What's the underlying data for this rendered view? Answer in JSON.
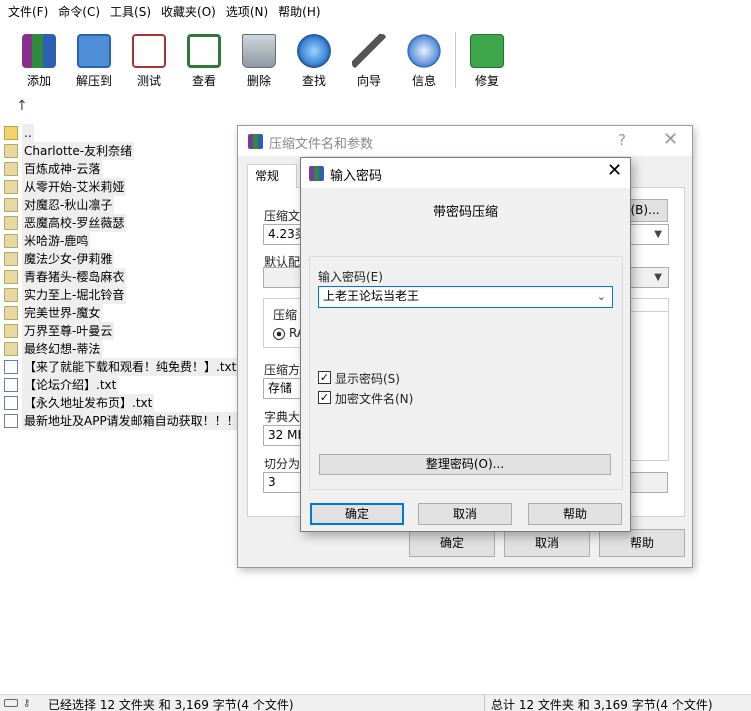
{
  "menu": [
    "文件(F)",
    "命令(C)",
    "工具(S)",
    "收藏夹(O)",
    "选项(N)",
    "帮助(H)"
  ],
  "toolbar": {
    "add": "添加",
    "extract": "解压到",
    "test": "测试",
    "view": "查看",
    "delete": "删除",
    "find": "查找",
    "wizard": "向导",
    "info": "信息",
    "repair": "修复"
  },
  "files": [
    {
      "name": "..",
      "type": "up"
    },
    {
      "name": "Charlotte-友利奈绪",
      "type": "folder"
    },
    {
      "name": "百炼成神-云落",
      "type": "folder"
    },
    {
      "name": "从零开始-艾米莉娅",
      "type": "folder"
    },
    {
      "name": "对魔忍-秋山凛子",
      "type": "folder"
    },
    {
      "name": "恶魔高校-罗丝薇瑟",
      "type": "folder"
    },
    {
      "name": "米哈游-鹿鸣",
      "type": "folder"
    },
    {
      "name": "魔法少女-伊莉雅",
      "type": "folder"
    },
    {
      "name": "青春猪头-樱岛麻衣",
      "type": "folder"
    },
    {
      "name": "实力至上-堀北铃音",
      "type": "folder"
    },
    {
      "name": "完美世界-魔女",
      "type": "folder"
    },
    {
      "name": "万界至尊-叶曼云",
      "type": "folder"
    },
    {
      "name": "最终幻想-蒂法",
      "type": "folder"
    },
    {
      "name": "【来了就能下载和观看！纯免费！】.txt",
      "type": "txt"
    },
    {
      "name": "【论坛介绍】.txt",
      "type": "txt"
    },
    {
      "name": "【永久地址发布页】.txt",
      "type": "txt"
    },
    {
      "name": "最新地址及APP请发邮箱自动获取！！！.",
      "type": "txt"
    }
  ],
  "status": {
    "left": "已经选择 12 文件夹 和 3,169 字节(4 个文件)",
    "right": "总计 12 文件夹 和 3,169 字节(4 个文件)"
  },
  "archive_dialog": {
    "title": "压缩文件名和参数",
    "help": "?",
    "close": "✕",
    "tab_general": "常规",
    "archive_name_label": "压缩文",
    "browse": "(B)...",
    "archive_name_value": "4.23买",
    "default_profile_label": "默认配",
    "format_label": "压缩",
    "format_rar": "RA",
    "method_label": "压缩方",
    "method_value": "存储",
    "dict_label": "字典大",
    "dict_value": "32 MB",
    "split_label": "切分为",
    "split_value": "3",
    "ok": "确定",
    "cancel": "取消",
    "help_btn": "帮助"
  },
  "password_dialog": {
    "title": "输入密码",
    "close": "✕",
    "heading": "带密码压缩",
    "password_label": "输入密码(E)",
    "password_value": "上老王论坛当老王",
    "show_password": "显示密码(S)",
    "encrypt_names": "加密文件名(N)",
    "show_password_checked": true,
    "encrypt_names_checked": true,
    "organize": "整理密码(O)...",
    "ok": "确定",
    "cancel": "取消",
    "help": "帮助"
  }
}
